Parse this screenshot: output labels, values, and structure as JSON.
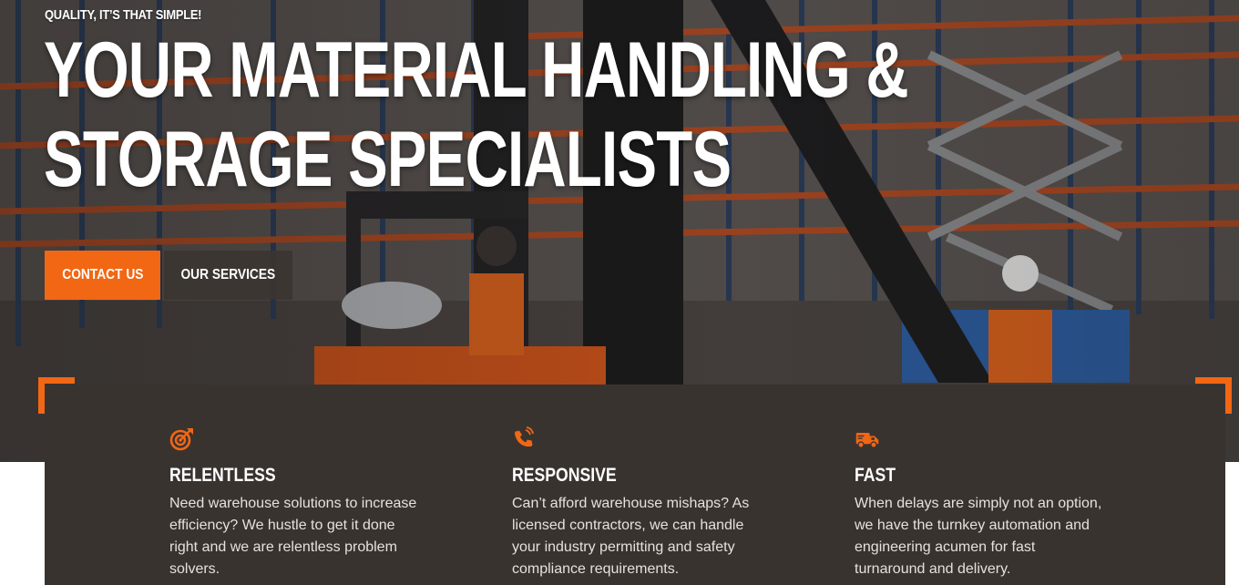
{
  "hero": {
    "eyebrow": "QUALITY, IT’S THAT SIMPLE!",
    "headline_line1": "YOUR MATERIAL HANDLING &",
    "headline_line2": "STORAGE SPECIALISTS",
    "background_image": "warehouse-forklift-scissor-lift-photo",
    "buttons": {
      "contact_label": "CONTACT US",
      "services_label": "OUR SERVICES"
    }
  },
  "features": [
    {
      "icon": "target-icon",
      "title": "RELENTLESS",
      "text": "Need warehouse solutions to increase efficiency? We hustle to get it done right and we are relentless problem solvers."
    },
    {
      "icon": "phone-volume-icon",
      "title": "RESPONSIVE",
      "text": "Can’t afford warehouse mishaps? As licensed contractors, we can handle your industry permitting and safety compliance requirements."
    },
    {
      "icon": "delivery-truck-icon",
      "title": "FAST",
      "text": "When delays are simply not an option, we have the turnkey automation and engineering acumen for fast turnaround and delivery."
    }
  ],
  "colors": {
    "accent": "#f26714",
    "card_bg": "#393330",
    "text_light": "#e6e1dd"
  }
}
